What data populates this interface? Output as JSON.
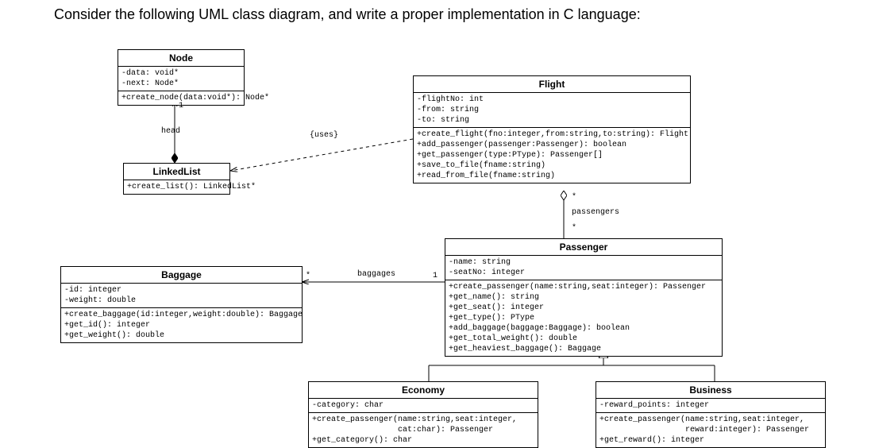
{
  "prompt": "Consider the following UML class diagram, and write a proper implementation in C language:",
  "node": {
    "title": "Node",
    "attrs": "-data: void*\n-next: Node*",
    "ops": "+create_node(data:void*): Node*"
  },
  "linkedlist": {
    "title": "LinkedList",
    "ops": "+create_list(): LinkedList*"
  },
  "flight": {
    "title": "Flight",
    "attrs": "-flightNo: int\n-from: string\n-to: string",
    "ops": "+create_flight(fno:integer,from:string,to:string): Flight\n+add_passenger(passenger:Passenger): boolean\n+get_passenger(type:PType): Passenger[]\n+save_to_file(fname:string)\n+read_from_file(fname:string)"
  },
  "baggage": {
    "title": "Baggage",
    "attrs": "-id: integer\n-weight: double",
    "ops": "+create_baggage(id:integer,weight:double): Baggage\n+get_id(): integer\n+get_weight(): double"
  },
  "passenger": {
    "title": "Passenger",
    "attrs": "-name: string\n-seatNo: integer",
    "ops": "+create_passenger(name:string,seat:integer): Passenger\n+get_name(): string\n+get_seat(): integer\n+get_type(): PType\n+add_baggage(baggage:Baggage): boolean\n+get_total_weight(): double\n+get_heaviest_baggage(): Baggage"
  },
  "economy": {
    "title": "Economy",
    "attrs": "-category: char",
    "ops": "+create_passenger(name:string,seat:integer,\n                  cat:char): Passenger\n+get_category(): char"
  },
  "business": {
    "title": "Business",
    "attrs": "-reward_points: integer",
    "ops": "+create_passenger(name:string,seat:integer,\n                  reward:integer): Passenger\n+get_reward(): integer"
  },
  "labels": {
    "uses": "{uses}",
    "head": "head",
    "one_node": "1",
    "baggages": "baggages",
    "bag_star": "*",
    "bag_one": "1",
    "passengers": "passengers",
    "pass_star1": "*",
    "pass_star2": "*"
  }
}
